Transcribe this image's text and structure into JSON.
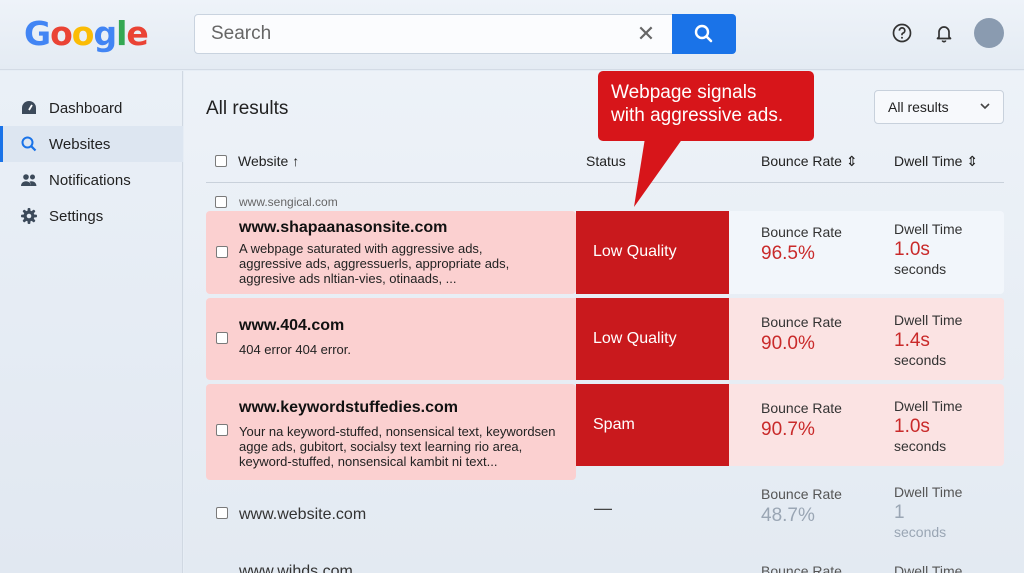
{
  "header": {
    "logo_letters": [
      {
        "ch": "G",
        "color": "#4285F4"
      },
      {
        "ch": "o",
        "color": "#EA4335"
      },
      {
        "ch": "o",
        "color": "#FBBC05"
      },
      {
        "ch": "g",
        "color": "#4285F4"
      },
      {
        "ch": "l",
        "color": "#34A853"
      },
      {
        "ch": "e",
        "color": "#EA4335"
      }
    ],
    "search_placeholder": "Search",
    "clear_symbol": "✕"
  },
  "sidebar": {
    "items": [
      {
        "label": "Dashboard",
        "icon": "dashboard-icon"
      },
      {
        "label": "Websites",
        "icon": "search-icon",
        "active": true
      },
      {
        "label": "Notifications",
        "icon": "people-icon"
      },
      {
        "label": "Settings",
        "icon": "gear-icon"
      }
    ]
  },
  "main": {
    "title": "All results",
    "filter": {
      "selected": "All results",
      "chevron": "⌄"
    },
    "columns": {
      "website": "Website ↑",
      "status": "Status",
      "bounce": "Bounce Rate ⇕",
      "dwell": "Dwell Time ⇕"
    },
    "sub_url": "www.sengical.com",
    "callout": "Webpage signals\nwith aggressive ads.",
    "rows": [
      {
        "url": "www.shapaanasonsite.com",
        "desc": "A webpage saturated with aggressive ads,\naggressive ads, aggressuerls, appropriate ads,\naggresive ads nltian-vies, otinaads, ...",
        "status": "Low Quality",
        "bounce_label": "Bounce Rate",
        "bounce": "96.5%",
        "dwell_label": "Dwell Time",
        "dwell": "1.0s",
        "dwell_unit": "seconds"
      },
      {
        "url": "www.404.com",
        "desc": "404 error 404 error.",
        "status": "Low Quality",
        "bounce_label": "Bounce Rate",
        "bounce": "90.0%",
        "dwell_label": "Dwell Time",
        "dwell": "1.4s",
        "dwell_unit": "seconds"
      },
      {
        "url": "www.keywordstuffedies.com",
        "desc": "Your na keyword-stuffed, nonsensical text, keywordsen\nagge ads, gubitort, socialsy text learning rio area,\nkeyword-stuffed, nonsensical kambit ni text...",
        "status": "Spam",
        "bounce_label": "Bounce Rate",
        "bounce": "90.7%",
        "dwell_label": "Dwell Time",
        "dwell": "1.0s",
        "dwell_unit": "seconds"
      },
      {
        "url": "www.website.com",
        "status": "—",
        "bounce_label": "Bounce Rate",
        "bounce": "48.7%",
        "dwell_label": "Dwell Time",
        "dwell": "1",
        "dwell_unit": "seconds"
      },
      {
        "url": "www.wihds.com",
        "bounce_label": "Bounce Rate",
        "dwell_label": "Dwell Time"
      }
    ]
  },
  "colors": {
    "accent": "#1a73e8",
    "danger": "#c9191d",
    "flag_bg": "#fbd0d0"
  }
}
